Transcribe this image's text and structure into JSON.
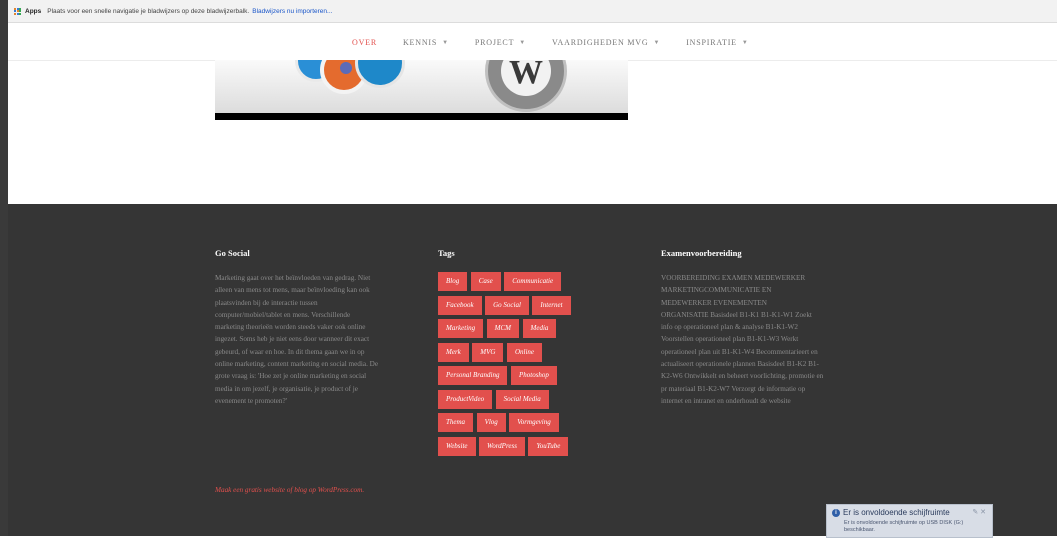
{
  "bookmark_bar": {
    "apps_label": "Apps",
    "message": "Plaats voor een snelle navigatie je bladwijzers op deze bladwijzerbalk.",
    "import_link": "Bladwijzers nu importeren..."
  },
  "nav": {
    "items": [
      {
        "label": "OVER",
        "active": true,
        "has_dropdown": false
      },
      {
        "label": "KENNIS",
        "has_dropdown": true
      },
      {
        "label": "PROJECT",
        "has_dropdown": true
      },
      {
        "label": "VAARDIGHEDEN MVG",
        "has_dropdown": true
      },
      {
        "label": "INSPIRATIE",
        "has_dropdown": true
      }
    ],
    "dropdown_icon": "chevron-down-icon",
    "active_color": "#e2504d"
  },
  "footer": {
    "background_color": "#353535",
    "go_social": {
      "title": "Go Social",
      "lines": [
        "Marketing gaat over het beïnvloeden van gedrag. Niet",
        "alleen van mens tot mens, maar beïnvloeding kan ook",
        "plaatsvinden bij de interactie tussen",
        "computer/mobiel/tablet en mens. Verschillende",
        "marketing theorieën worden steeds vaker ook online",
        "ingezet. Soms heb je niet eens door wanneer dit exact",
        "gebeurd, of waar en hoe. In dit thema gaan we in op",
        "online marketing, content marketing en social media. De",
        "grote vraag is: 'Hoe zet je online marketing en social",
        "media in om jezelf, je organisatie, je product of je",
        "evenement te promoten?'"
      ]
    },
    "tags": {
      "title": "Tags",
      "rows": [
        [
          "Blog",
          "Case",
          "Communicatie"
        ],
        [
          "Facebook",
          "Go Social",
          "Internet"
        ],
        [
          "Marketing",
          "MCM",
          "Media"
        ],
        [
          "Merk",
          "MVG",
          "Online"
        ],
        [
          "Personal Branding",
          "Photoshop"
        ],
        [
          "ProductVideo",
          "Social Media"
        ],
        [
          "Thema",
          "Vlog",
          "Vormgeving"
        ],
        [
          "Website",
          "WordPress",
          "YouTube"
        ]
      ],
      "tag_color": "#e2504d"
    },
    "exam": {
      "title": "Examenvoorbereiding",
      "lines": [
        "VOORBEREIDING EXAMEN MEDEWERKER",
        "MARKETINGCOMMUNICATIE EN",
        "MEDEWERKER EVENEMENTEN",
        "ORGANISATIE Basisdeel B1-K1 B1-K1-W1 Zoekt",
        "info op operationeel plan & analyse B1-K1-W2",
        "Voorstellen operationeel plan B1-K1-W3 Werkt",
        "operationeel plan uit B1-K1-W4 Becommentarieert en",
        "actualiseert operationele plannen Basisdeel B1-K2 B1-",
        "K2-W6 Ontwikkelt en beheert voorlichting, promotie en",
        "pr materiaal B1-K2-W7 Verzorgt de informatie op",
        "internet en intranet en onderhoudt de website"
      ]
    },
    "credit_link": "Maak een gratis website of blog op WordPress.com."
  },
  "notification": {
    "icon": "info-icon",
    "title": "Er is onvoldoende schijfruimte",
    "body": "Er is onvoldoende schijfruimte op USB DISK (G:) beschikbaar."
  }
}
